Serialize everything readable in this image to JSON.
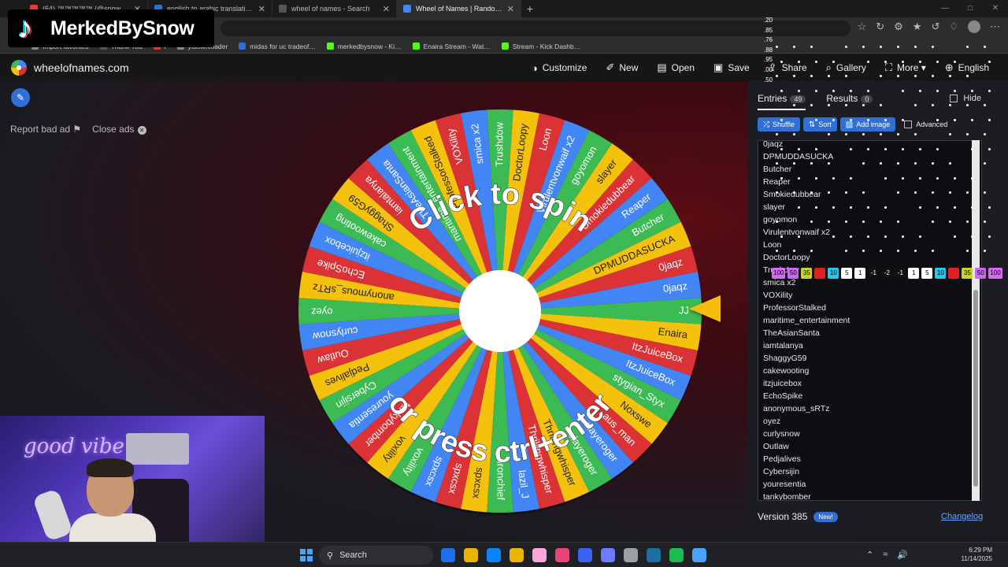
{
  "browser": {
    "tabs": [
      {
        "label": "(64) ™™™™™ (@snowbender…",
        "color": "#e53935",
        "active": false
      },
      {
        "label": "english to arabic translation - Sea…",
        "color": "#2f6fd6",
        "active": false
      },
      {
        "label": "wheel of names - Search",
        "color": "#555",
        "active": false
      },
      {
        "label": "Wheel of Names | Random name…",
        "color": "#4285f4",
        "active": true
      }
    ],
    "bookmarks": [
      {
        "label": "Import favorites",
        "color": "#888"
      },
      {
        "label": "Thank You",
        "color": "#555"
      },
      {
        "label": "i",
        "color": "#e53935"
      },
      {
        "label": "ytdownloader",
        "color": "#888"
      },
      {
        "label": "midas for uc tradeof…",
        "color": "#2f6fd6"
      },
      {
        "label": "merkedbysnow - Ki…",
        "color": "#53fc18"
      },
      {
        "label": "Enaira Stream - Wat…",
        "color": "#53fc18"
      },
      {
        "label": "Stream - Kick Dashb…",
        "color": "#53fc18"
      }
    ]
  },
  "site": {
    "name": "wheelofnames.com",
    "nav": [
      {
        "id": "customize",
        "label": "Customize",
        "icon": "◑"
      },
      {
        "id": "new",
        "label": "New",
        "icon": "✐"
      },
      {
        "id": "open",
        "label": "Open",
        "icon": "▤"
      },
      {
        "id": "save",
        "label": "Save",
        "icon": "▣"
      },
      {
        "id": "share",
        "label": "Share",
        "icon": "⇪"
      },
      {
        "id": "gallery",
        "label": "Gallery",
        "icon": "⌕"
      },
      {
        "id": "more",
        "label": "More ▾",
        "icon": "⛶"
      },
      {
        "id": "language",
        "label": "English",
        "icon": "⊕"
      }
    ],
    "report_ad": "Report bad ad",
    "close_ads": "Close ads"
  },
  "wheel": {
    "top_text": "Click to spin",
    "bottom_text": "or press ctrl+enter",
    "colors": [
      "#3cba54",
      "#f4c20d",
      "#db3236",
      "#4285f4"
    ],
    "segments": [
      "JJ",
      "Enaira",
      "ItzJuiceBox",
      "ItzJuiceBox",
      "stygian_Styx",
      "Noxswe",
      "aus_man",
      "slayeroger",
      "slayeroger",
      "Thrillingwhisper",
      "Thrillingwhisper",
      "lazil_J",
      "Ironchief",
      "spxcsx",
      "spxcsx",
      "spxcsx",
      "voxility",
      "voxility",
      "tankybomber",
      "youresentia",
      "Cybersijin",
      "Pedjalives",
      "Outlaw",
      "curlysnow",
      "oyez",
      "anonymous_sRTz",
      "EchoSpike",
      "itzjuicebox",
      "cakewooting",
      "ShaggyG59",
      "iamtalanya",
      "TheAsianSanta",
      "maritime_entertainment",
      "ProfessorStalked",
      "VOXility",
      "smica x2",
      "Trushdow",
      "DoctorLoopy",
      "Loon",
      "Virulentvonwaif x2",
      "goyomon",
      "slayer",
      "Smokiedubbear",
      "Reaper",
      "Butcher",
      "DPMUDDASUCKA",
      "0jaqz",
      "0jaqz"
    ]
  },
  "panel": {
    "entries_label": "Entries",
    "entries_count": "49",
    "results_label": "Results",
    "results_count": "0",
    "hide_label": "Hide",
    "tools": [
      {
        "label": "Shuffle",
        "icon": "⤮"
      },
      {
        "label": "Sort",
        "icon": "⇅"
      },
      {
        "label": "Add image",
        "icon": "▨"
      }
    ],
    "advanced_label": "Advanced",
    "entries": [
      "0jaqz",
      "DPMUDDASUCKA",
      "Butcher",
      "Reaper",
      "Smokiedubbear",
      "slayer",
      "goyomon",
      "Virulentvonwaif x2",
      "Loon",
      "DoctorLoopy",
      "Trushdow",
      "smica x2",
      "VOXility",
      "ProfessorStalked",
      "maritime_entertainment",
      "TheAsianSanta",
      "iamtalanya",
      "ShaggyG59",
      "cakewooting",
      "itzjuicebox",
      "EchoSpike",
      "anonymous_sRTz",
      "oyez",
      "curlysnow",
      "Outlaw",
      "Pedjalives",
      "Cybersijin",
      "youresentia",
      "tankybomber"
    ],
    "version": "Version 385",
    "new_badge": "New!",
    "changelog": "Changelog"
  },
  "overlay": {
    "brand": "MerkedBySnow",
    "neon_text": "good vibe",
    "stat_numbers": [
      ".20",
      ".85",
      ".76",
      ".88",
      ".95",
      ".00",
      ".50"
    ],
    "chips": [
      {
        "label": "100",
        "color": "#d36cf0"
      },
      {
        "label": "50",
        "color": "#c86af0"
      },
      {
        "label": "35",
        "color": "#c9d42a"
      },
      {
        "label": "",
        "color": "#e02020"
      },
      {
        "label": "10",
        "color": "#27c9e6"
      },
      {
        "label": "5",
        "color": "#ffffff"
      },
      {
        "label": "1",
        "color": "#ffffff"
      },
      {
        "label": "-1",
        "color": "#111111"
      },
      {
        "label": "-2",
        "color": "#111111"
      },
      {
        "label": "-1",
        "color": "#111111"
      },
      {
        "label": "1",
        "color": "#ffffff"
      },
      {
        "label": "5",
        "color": "#ffffff"
      },
      {
        "label": "10",
        "color": "#27c9e6"
      },
      {
        "label": "",
        "color": "#e02020"
      },
      {
        "label": "35",
        "color": "#c9d42a"
      },
      {
        "label": "50",
        "color": "#c86af0"
      },
      {
        "label": "100",
        "color": "#d36cf0"
      }
    ]
  },
  "taskbar": {
    "search_label": "Search",
    "time": "6:29 PM",
    "date": "11/14/2025",
    "apps": [
      "#1f6feb",
      "#e8b400",
      "#0a84ff",
      "#e8b400",
      "#f6a6d8",
      "#e8457a",
      "#3c62f4",
      "#6d7cff",
      "#9aa0a6",
      "#1c6ea4",
      "#1db954",
      "#4aa3ff"
    ]
  }
}
